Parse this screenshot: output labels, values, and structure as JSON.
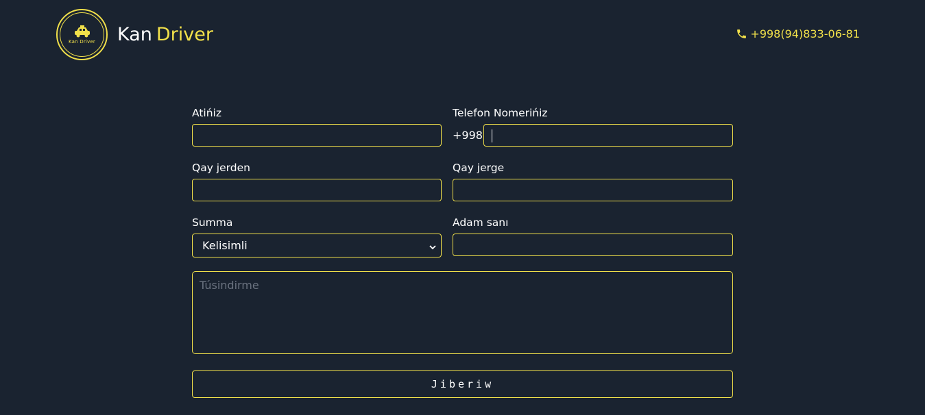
{
  "header": {
    "logo_text": "Kan Driver",
    "brand_first": "Kan",
    "brand_second": "Driver",
    "phone": "+998(94)833-06-81"
  },
  "form": {
    "name_label": "Atińiz",
    "name_value": "",
    "phone_label": "Telefon Nomerińiz",
    "phone_prefix": "+998",
    "phone_value": "",
    "from_label": "Qay jerden",
    "from_value": "",
    "to_label": "Qay jerge",
    "to_value": "",
    "sum_label": "Summa",
    "sum_selected": "Kelisimli",
    "people_label": "Adam sanı",
    "people_value": "",
    "description_placeholder": "Túsindirme",
    "submit_label": "Jiberiw"
  },
  "colors": {
    "background": "#1a2330",
    "accent": "#f1e04a",
    "text": "#ffffff"
  },
  "icons": [
    "taxi-car-icon",
    "phone-icon",
    "chevron-down-icon"
  ]
}
